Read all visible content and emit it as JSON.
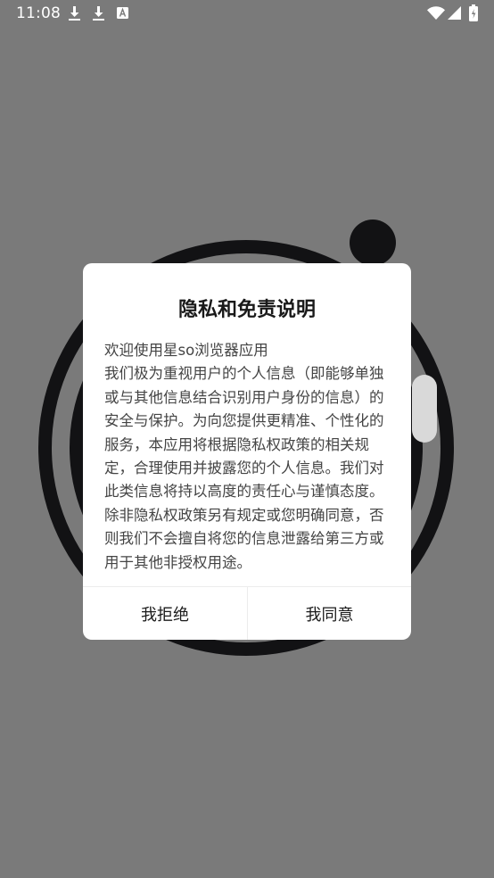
{
  "status_bar": {
    "time": "11:08",
    "left_icons": [
      "download-icon",
      "download-icon",
      "text-notification-icon"
    ],
    "right_icons": [
      "wifi-icon",
      "cellular-signal-icon",
      "battery-icon"
    ]
  },
  "dialog": {
    "title": "隐私和免责说明",
    "intro": "欢迎使用星so浏览器应用",
    "body": "我们极为重视用户的个人信息（即能够单独或与其他信息结合识别用户身份的信息）的安全与保护。为向您提供更精准、个性化的服务，本应用将根据隐私权政策的相关规定，合理使用并披露您的个人信息。我们对此类信息将持以高度的责任心与谨慎态度。除非隐私权政策另有规定或您明确同意，否则我们不会擅自将您的信息泄露给第三方或用于其他非授权用途。",
    "reject_label": "我拒绝",
    "agree_label": "我同意"
  },
  "colors": {
    "overlay": "#7a7a7a",
    "logo_dark": "#141416",
    "dialog_bg": "#ffffff",
    "text_primary": "#1a1a1a",
    "text_body": "#444444"
  }
}
